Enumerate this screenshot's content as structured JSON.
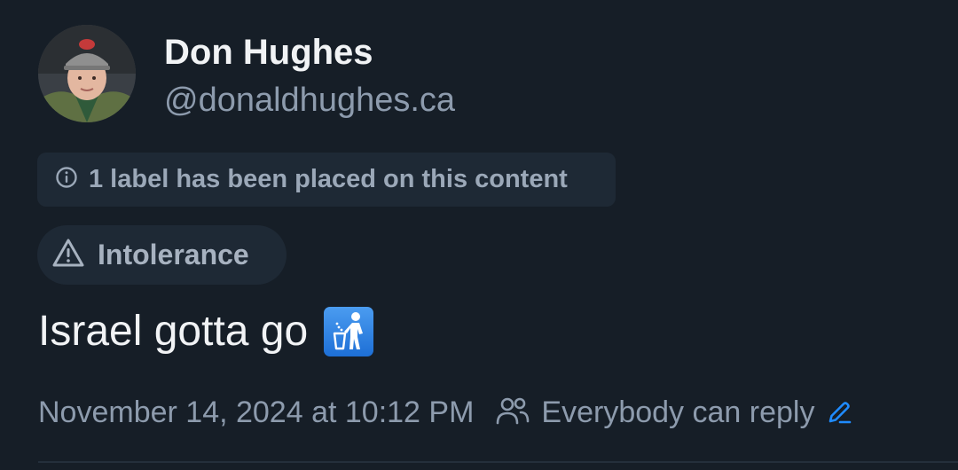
{
  "author": {
    "name": "Don Hughes",
    "handle": "@donaldhughes.ca",
    "avatar_icon": "user-avatar"
  },
  "moderation": {
    "notice_icon": "info-circle-icon",
    "notice_text": "1 label has been placed on this content",
    "label_icon": "warning-triangle-icon",
    "label_text": "Intolerance"
  },
  "post": {
    "text": "Israel gotta go",
    "emoji_icon": "put-litter-in-its-place-emoji"
  },
  "meta": {
    "timestamp": "November 14, 2024 at 10:12 PM",
    "reply_icon": "people-icon",
    "reply_setting": "Everybody can reply",
    "edit_icon": "pencil-icon"
  },
  "colors": {
    "background": "#161e27",
    "chip_background": "#1e2935",
    "primary_text": "#f1f3f5",
    "secondary_text": "#8d9bad",
    "accent": "#1f8bff"
  }
}
